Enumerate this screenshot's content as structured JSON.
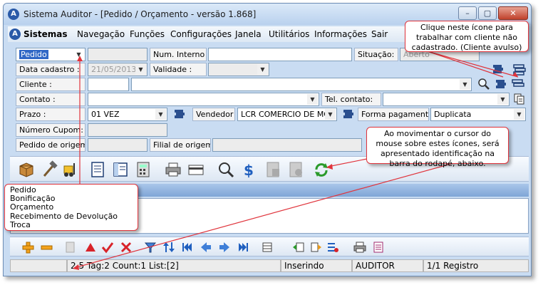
{
  "window": {
    "title": "Sistema Auditor - [Pedido / Orçamento - versão 1.868]",
    "minimize": "–",
    "maximize": "▢",
    "close": "✕"
  },
  "menu": {
    "app": "Sistemas",
    "items": [
      "Navegação",
      "Funções",
      "Configurações",
      "Janela",
      "Utilitários",
      "Informações",
      "Sair"
    ]
  },
  "form": {
    "tipo": "Pedido",
    "num_interno_label": "Num. Interno :",
    "situacao_label": "Situação:",
    "situacao_value": "Aberto",
    "data_cadastro_label": "Data cadastro :",
    "data_cadastro_value": "21/05/2013",
    "validade_label": "Validade :",
    "cliente_label": "Cliente :",
    "contato_label": "Contato :",
    "tel_contato_label": "Tel. contato:",
    "prazo_label": "Prazo :",
    "prazo_value": "01 VEZ",
    "vendedor_label": "Vendedor :",
    "vendedor_value": "LCR COMERCIO DE MO",
    "forma_pagamento_label": "Forma pagamento:",
    "forma_pagamento_value": "Duplicata",
    "numero_cupom_label": "Número Cupom:",
    "pedido_origem_label": "Pedido de origem:",
    "filial_origem_label": "Filial de origem:"
  },
  "status": {
    "info": "2.5 Tag:2 Count:1 List:[2]",
    "mode": "Inserindo",
    "user": "AUDITOR",
    "records": "1/1 Registro"
  },
  "callouts": {
    "avulso": "Clique neste ícone para trabalhar com cliente não cadastrado. (Cliente avulso)",
    "rodape": "Ao movimentar o cursor do mouse sobre estes ícones, será apresentado identificação na barra do rodapé, abaixo.",
    "tipos": [
      "Pedido",
      "Bonificação",
      "Orçamento",
      "Recebimento de Devolução",
      "Troca"
    ]
  },
  "colors": {
    "accent": "#e0343c",
    "selection": "#3168c6"
  }
}
